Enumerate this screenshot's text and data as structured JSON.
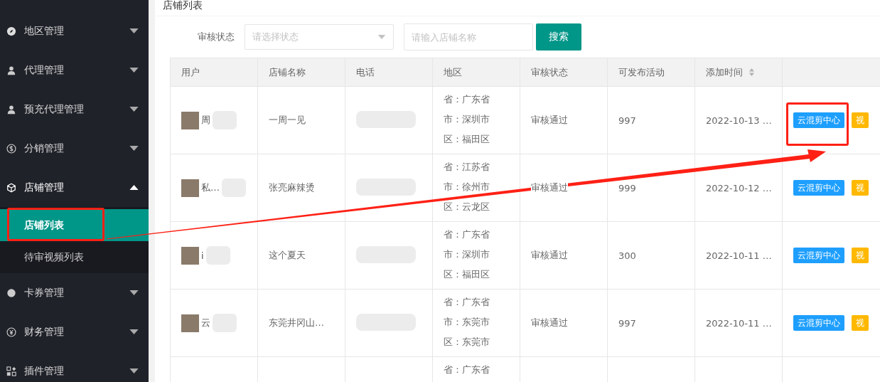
{
  "sidebar": {
    "items": [
      {
        "label": "地区管理",
        "expanded": false
      },
      {
        "label": "代理管理",
        "expanded": false
      },
      {
        "label": "预充代理管理",
        "expanded": false
      },
      {
        "label": "分销管理",
        "expanded": false
      },
      {
        "label": "店铺管理",
        "expanded": true,
        "children": [
          {
            "label": "店铺列表",
            "selected": true
          },
          {
            "label": "待审视频列表",
            "selected": false
          }
        ]
      },
      {
        "label": "卡券管理",
        "expanded": false
      },
      {
        "label": "财务管理",
        "expanded": false
      },
      {
        "label": "插件管理",
        "expanded": false
      }
    ]
  },
  "page_title": "店铺列表",
  "filter": {
    "label": "审核状态",
    "status_select": {
      "placeholder": "请选择状态"
    },
    "name_input": {
      "placeholder": "请输入店铺名称"
    },
    "search_button": "搜索"
  },
  "table": {
    "columns": [
      {
        "label": "用户",
        "sortable": false
      },
      {
        "label": "店铺名称",
        "sortable": false
      },
      {
        "label": "电话",
        "sortable": false
      },
      {
        "label": "地区",
        "sortable": false
      },
      {
        "label": "审核状态",
        "sortable": false
      },
      {
        "label": "可发布活动",
        "sortable": false
      },
      {
        "label": "添加时间",
        "sortable": true
      },
      {
        "sortable": false
      }
    ],
    "rows": [
      {
        "user": "周",
        "shop": "一周一见",
        "region": [
          "省：广东省",
          "市：深圳市",
          "区：福田区"
        ],
        "status": "审核通过",
        "activities": "997",
        "added": "2022-10-13 …",
        "actions": [
          {
            "label": "云混剪中心",
            "color": "#1e9fff"
          },
          {
            "label": "视",
            "color": "#ffb800"
          }
        ]
      },
      {
        "user": "私…",
        "shop": "张亮麻辣烫",
        "region": [
          "省：江苏省",
          "市：徐州市",
          "区：云龙区"
        ],
        "status": "审核通过",
        "activities": "999",
        "added": "2022-10-12 …",
        "actions": [
          {
            "label": "云混剪中心",
            "color": "#1e9fff"
          },
          {
            "label": "视",
            "color": "#ffb800"
          }
        ]
      },
      {
        "user": "i",
        "shop": "这个夏天",
        "region": [
          "省：广东省",
          "市：深圳市",
          "区：福田区"
        ],
        "status": "审核通过",
        "activities": "300",
        "added": "2022-10-11 …",
        "actions": [
          {
            "label": "云混剪中心",
            "color": "#1e9fff"
          },
          {
            "label": "视",
            "color": "#ffb800"
          }
        ]
      },
      {
        "user": "云",
        "shop": "东莞井冈山…",
        "region": [
          "省：广东省",
          "市：东莞市",
          "区：东莞市"
        ],
        "status": "审核通过",
        "activities": "997",
        "added": "2022-10-11 …",
        "actions": [
          {
            "label": "云混剪中心",
            "color": "#1e9fff"
          },
          {
            "label": "视",
            "color": "#ffb800"
          }
        ]
      },
      {
        "region": [
          "省：广东省"
        ]
      }
    ]
  }
}
